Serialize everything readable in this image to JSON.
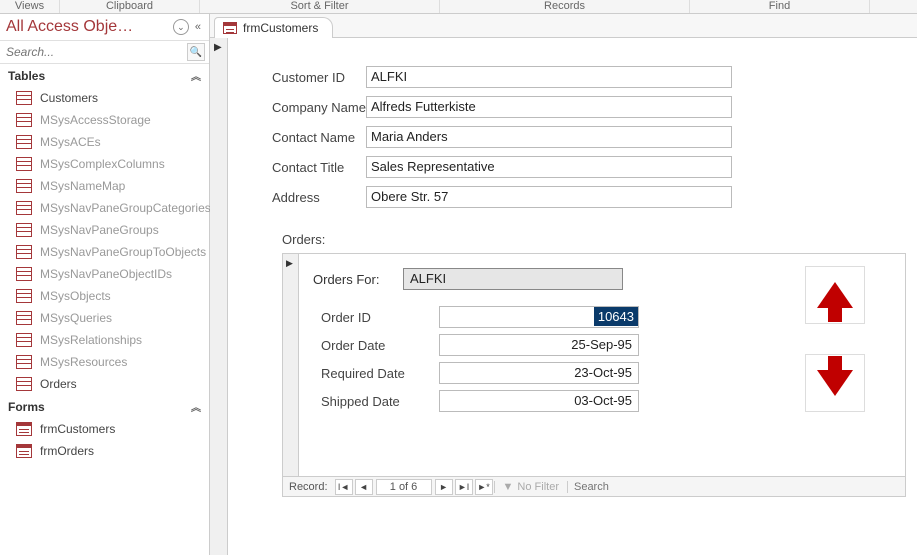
{
  "ribbon": {
    "groups": [
      "Views",
      "Clipboard",
      "Sort & Filter",
      "Records",
      "Find"
    ],
    "widths": [
      60,
      140,
      240,
      250,
      180
    ]
  },
  "nav": {
    "title": "All Access Obje…",
    "search_placeholder": "Search...",
    "sections": [
      {
        "name": "Tables",
        "items": [
          {
            "label": "Customers",
            "dim": false
          },
          {
            "label": "MSysAccessStorage",
            "dim": true
          },
          {
            "label": "MSysACEs",
            "dim": true
          },
          {
            "label": "MSysComplexColumns",
            "dim": true
          },
          {
            "label": "MSysNameMap",
            "dim": true
          },
          {
            "label": "MSysNavPaneGroupCategories",
            "dim": true
          },
          {
            "label": "MSysNavPaneGroups",
            "dim": true
          },
          {
            "label": "MSysNavPaneGroupToObjects",
            "dim": true
          },
          {
            "label": "MSysNavPaneObjectIDs",
            "dim": true
          },
          {
            "label": "MSysObjects",
            "dim": true
          },
          {
            "label": "MSysQueries",
            "dim": true
          },
          {
            "label": "MSysRelationships",
            "dim": true
          },
          {
            "label": "MSysResources",
            "dim": true
          },
          {
            "label": "Orders",
            "dim": false
          }
        ]
      },
      {
        "name": "Forms",
        "items": [
          {
            "label": "frmCustomers",
            "dim": false
          },
          {
            "label": "frmOrders",
            "dim": false
          }
        ]
      }
    ]
  },
  "tab": {
    "title": "frmCustomers"
  },
  "customer": {
    "labels": {
      "customer_id": "Customer ID",
      "company_name": "Company Name",
      "contact_name": "Contact Name",
      "contact_title": "Contact Title",
      "address": "Address"
    },
    "values": {
      "customer_id": "ALFKI",
      "company_name": "Alfreds Futterkiste",
      "contact_name": "Maria Anders",
      "contact_title": "Sales Representative",
      "address": "Obere Str. 57"
    }
  },
  "orders": {
    "section_label": "Orders:",
    "for_label": "Orders For:",
    "for_value": "ALFKI",
    "labels": {
      "order_id": "Order ID",
      "order_date": "Order Date",
      "required_date": "Required Date",
      "shipped_date": "Shipped Date"
    },
    "values": {
      "order_id": "10643",
      "order_date": "25-Sep-95",
      "required_date": "23-Oct-95",
      "shipped_date": "03-Oct-95"
    }
  },
  "recordnav": {
    "label": "Record:",
    "counter": "1 of 6",
    "no_filter": "No Filter",
    "search": "Search"
  }
}
